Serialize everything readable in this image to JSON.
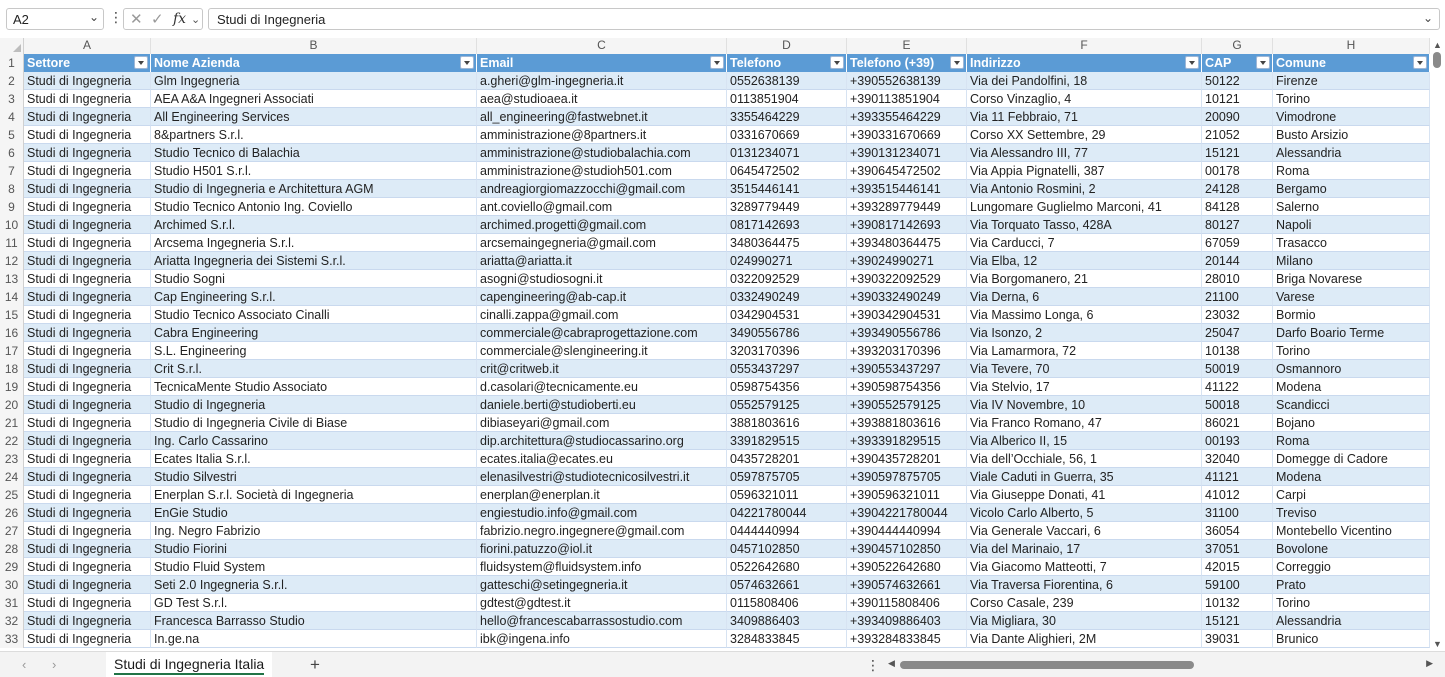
{
  "formula_bar": {
    "name_box": "A2",
    "formula": "Studi di Ingegneria"
  },
  "column_letters": [
    "A",
    "B",
    "C",
    "D",
    "E",
    "F",
    "G",
    "H"
  ],
  "headers": [
    "Settore",
    "Nome Azienda",
    "Email",
    "Telefono",
    "Telefono (+39)",
    "Indirizzo",
    "CAP",
    "Comune"
  ],
  "rows": [
    [
      "2",
      "Studi di Ingegneria",
      "Glm Ingegneria",
      "a.gheri@glm-ingegneria.it",
      "0552638139",
      "+390552638139",
      "Via dei Pandolfini, 18",
      "50122",
      "Firenze"
    ],
    [
      "3",
      "Studi di Ingegneria",
      "AEA A&A Ingegneri Associati",
      "aea@studioaea.it",
      "0113851904",
      "+390113851904",
      "Corso Vinzaglio, 4",
      "10121",
      "Torino"
    ],
    [
      "4",
      "Studi di Ingegneria",
      "All Engineering Services",
      "all_engineering@fastwebnet.it",
      "3355464229",
      "+393355464229",
      "Via 11 Febbraio, 71",
      "20090",
      "Vimodrone"
    ],
    [
      "5",
      "Studi di Ingegneria",
      "8&partners S.r.l.",
      "amministrazione@8partners.it",
      "0331670669",
      "+390331670669",
      "Corso XX Settembre, 29",
      "21052",
      "Busto Arsizio"
    ],
    [
      "6",
      "Studi di Ingegneria",
      "Studio Tecnico di Balachia",
      "amministrazione@studiobalachia.com",
      "0131234071",
      "+390131234071",
      "Via Alessandro III, 77",
      "15121",
      "Alessandria"
    ],
    [
      "7",
      "Studi di Ingegneria",
      "Studio H501 S.r.l.",
      "amministrazione@studioh501.com",
      "0645472502",
      "+390645472502",
      "Via Appia Pignatelli, 387",
      "00178",
      "Roma"
    ],
    [
      "8",
      "Studi di Ingegneria",
      "Studio di Ingegneria e Architettura AGM",
      "andreagiorgiomazzocchi@gmail.com",
      "3515446141",
      "+393515446141",
      "Via Antonio Rosmini, 2",
      "24128",
      "Bergamo"
    ],
    [
      "9",
      "Studi di Ingegneria",
      "Studio Tecnico Antonio Ing. Coviello",
      "ant.coviello@gmail.com",
      "3289779449",
      "+393289779449",
      "Lungomare Guglielmo Marconi, 41",
      "84128",
      "Salerno"
    ],
    [
      "10",
      "Studi di Ingegneria",
      "Archimed S.r.l.",
      "archimed.progetti@gmail.com",
      "0817142693",
      "+390817142693",
      "Via Torquato Tasso, 428A",
      "80127",
      "Napoli"
    ],
    [
      "11",
      "Studi di Ingegneria",
      "Arcsema Ingegneria S.r.l.",
      "arcsemaingegneria@gmail.com",
      "3480364475",
      "+393480364475",
      "Via Carducci, 7",
      "67059",
      "Trasacco"
    ],
    [
      "12",
      "Studi di Ingegneria",
      "Ariatta Ingegneria dei Sistemi S.r.l.",
      "ariatta@ariatta.it",
      "024990271",
      "+39024990271",
      "Via Elba, 12",
      "20144",
      "Milano"
    ],
    [
      "13",
      "Studi di Ingegneria",
      "Studio Sogni",
      "asogni@studiosogni.it",
      "0322092529",
      "+390322092529",
      "Via Borgomanero, 21",
      "28010",
      "Briga Novarese"
    ],
    [
      "14",
      "Studi di Ingegneria",
      "Cap Engineering S.r.l.",
      "capengineering@ab-cap.it",
      "0332490249",
      "+390332490249",
      "Via Derna, 6",
      "21100",
      "Varese"
    ],
    [
      "15",
      "Studi di Ingegneria",
      "Studio Tecnico Associato Cinalli",
      "cinalli.zappa@gmail.com",
      "0342904531",
      "+390342904531",
      "Via Massimo Longa, 6",
      "23032",
      "Bormio"
    ],
    [
      "16",
      "Studi di Ingegneria",
      "Cabra Engineering",
      "commerciale@cabraprogettazione.com",
      "3490556786",
      "+393490556786",
      "Via Isonzo, 2",
      "25047",
      "Darfo Boario Terme"
    ],
    [
      "17",
      "Studi di Ingegneria",
      "S.L. Engineering",
      "commerciale@slengineering.it",
      "3203170396",
      "+393203170396",
      "Via Lamarmora, 72",
      "10138",
      "Torino"
    ],
    [
      "18",
      "Studi di Ingegneria",
      "Crit S.r.l.",
      "crit@critweb.it",
      "0553437297",
      "+390553437297",
      "Via Tevere, 70",
      "50019",
      "Osmannoro"
    ],
    [
      "19",
      "Studi di Ingegneria",
      "TecnicaMente Studio Associato",
      "d.casolari@tecnicamente.eu",
      "0598754356",
      "+390598754356",
      "Via Stelvio, 17",
      "41122",
      "Modena"
    ],
    [
      "20",
      "Studi di Ingegneria",
      "Studio di Ingegneria",
      "daniele.berti@studioberti.eu",
      "0552579125",
      "+390552579125",
      "Via IV Novembre, 10",
      "50018",
      "Scandicci"
    ],
    [
      "21",
      "Studi di Ingegneria",
      "Studio di Ingegneria Civile di Biase",
      "dibiaseyari@gmail.com",
      "3881803616",
      "+393881803616",
      "Via Franco Romano, 47",
      "86021",
      "Bojano"
    ],
    [
      "22",
      "Studi di Ingegneria",
      "Ing. Carlo Cassarino",
      "dip.architettura@studiocassarino.org",
      "3391829515",
      "+393391829515",
      "Via Alberico II, 15",
      "00193",
      "Roma"
    ],
    [
      "23",
      "Studi di Ingegneria",
      "Ecates Italia S.r.l.",
      "ecates.italia@ecates.eu",
      "0435728201",
      "+390435728201",
      "Via dell’Occhiale, 56, 1",
      "32040",
      "Domegge di Cadore"
    ],
    [
      "24",
      "Studi di Ingegneria",
      "Studio Silvestri",
      "elenasilvestri@studiotecnicosilvestri.it",
      "0597875705",
      "+390597875705",
      "Viale Caduti in Guerra, 35",
      "41121",
      "Modena"
    ],
    [
      "25",
      "Studi di Ingegneria",
      "Enerplan S.r.l. Società di Ingegneria",
      "enerplan@enerplan.it",
      "0596321011",
      "+390596321011",
      "Via Giuseppe Donati, 41",
      "41012",
      "Carpi"
    ],
    [
      "26",
      "Studi di Ingegneria",
      "EnGie Studio",
      "engiestudio.info@gmail.com",
      "04221780044",
      "+3904221780044",
      "Vicolo Carlo Alberto, 5",
      "31100",
      "Treviso"
    ],
    [
      "27",
      "Studi di Ingegneria",
      "Ing. Negro Fabrizio",
      "fabrizio.negro.ingegnere@gmail.com",
      "0444440994",
      "+390444440994",
      "Via Generale Vaccari, 6",
      "36054",
      "Montebello Vicentino"
    ],
    [
      "28",
      "Studi di Ingegneria",
      "Studio Fiorini",
      "fiorini.patuzzo@iol.it",
      "0457102850",
      "+390457102850",
      "Via del Marinaio, 17",
      "37051",
      "Bovolone"
    ],
    [
      "29",
      "Studi di Ingegneria",
      "Studio Fluid System",
      "fluidsystem@fluidsystem.info",
      "0522642680",
      "+390522642680",
      "Via Giacomo Matteotti, 7",
      "42015",
      "Correggio"
    ],
    [
      "30",
      "Studi di Ingegneria",
      "Seti 2.0 Ingegneria S.r.l.",
      "gatteschi@setingegneria.it",
      "0574632661",
      "+390574632661",
      "Via Traversa Fiorentina, 6",
      "59100",
      "Prato"
    ],
    [
      "31",
      "Studi di Ingegneria",
      "GD Test S.r.l.",
      "gdtest@gdtest.it",
      "0115808406",
      "+390115808406",
      "Corso Casale, 239",
      "10132",
      "Torino"
    ],
    [
      "32",
      "Studi di Ingegneria",
      "Francesca Barrasso Studio",
      "hello@francescabarrassostudio.com",
      "3409886403",
      "+393409886403",
      "Via Migliara, 30",
      "15121",
      "Alessandria"
    ],
    [
      "33",
      "Studi di Ingegneria",
      "In.ge.na",
      "ibk@ingena.info",
      "3284833845",
      "+393284833845",
      "Via Dante Alighieri, 2M",
      "39031",
      "Brunico"
    ]
  ],
  "header_row_number": "1",
  "sheet_tabs": [
    "Studi di Ingegneria Italia"
  ],
  "icons": {
    "cancel": "✕",
    "enter": "✓",
    "fx": "fx",
    "chevron": "⌄",
    "more": "⋮",
    "add": "+",
    "prev": "‹",
    "next": "›"
  },
  "colors": {
    "header_fill": "#5b9bd5",
    "band_fill": "#ddebf7",
    "tab_underline": "#217346"
  }
}
